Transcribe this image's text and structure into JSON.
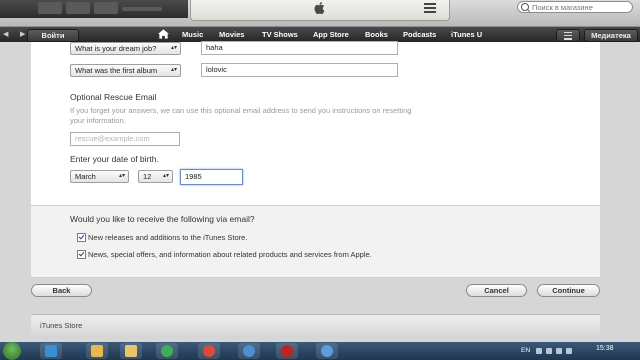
{
  "toolbar": {
    "search_placeholder": "Поиск в магазине"
  },
  "nav": {
    "signin_label": "Войти",
    "links": [
      "Music",
      "Movies",
      "TV Shows",
      "App Store",
      "Books",
      "Podcasts",
      "iTunes U"
    ],
    "library_label": "Медиатека"
  },
  "form": {
    "questions": [
      {
        "select": "What is your dream job?",
        "answer": "haha"
      },
      {
        "select": "What was the first album",
        "answer": "lolovic"
      }
    ],
    "rescue_title": "Optional Rescue Email",
    "rescue_help": "If you forget your answers, we can use this optional email address to send you instructions on resetting your information.",
    "rescue_placeholder": "rescue@example.com",
    "dob_label": "Enter your date of birth.",
    "dob_month": "March",
    "dob_day": "12",
    "dob_year": "1985"
  },
  "email_prefs": {
    "question": "Would you like to receive the following via email?",
    "options": [
      {
        "label": "New releases and additions to the iTunes Store.",
        "checked": true
      },
      {
        "label": "News, special offers, and information about related products and services from Apple.",
        "checked": true
      }
    ]
  },
  "buttons": {
    "back": "Back",
    "cancel": "Cancel",
    "continue": "Continue"
  },
  "footer": {
    "label": "iTunes Store"
  },
  "taskbar": {
    "lang": "EN",
    "time": "15:38"
  }
}
